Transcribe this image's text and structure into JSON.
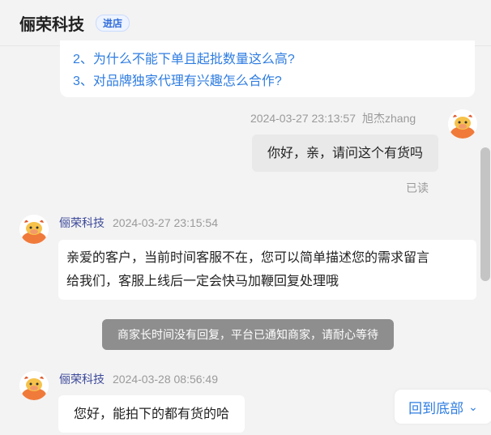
{
  "header": {
    "shop_name": "俪荣科技",
    "badge": "进店"
  },
  "faq": {
    "items": [
      "2、为什么不能下单且起批数量这么高?",
      "3、对品牌独家代理有兴趣怎么合作?"
    ]
  },
  "messages": [
    {
      "sender": "旭杰zhang",
      "time": "2024-03-27 23:13:57",
      "text": "你好，亲，请问这个有货吗",
      "status": "已读"
    },
    {
      "sender": "俪荣科技",
      "time": "2024-03-27 23:15:54",
      "lines": [
        "亲爱的客户，当前时间客服不在，您可以简单描述您的需求留言",
        "给我们，客服上线后一定会快马加鞭回复处理哦"
      ]
    },
    {
      "sender": "俪荣科技",
      "time": "2024-03-28 08:56:49",
      "text": "您好，能拍下的都有货的哈"
    }
  ],
  "system_notice": "商家长时间没有回复，平台已通知商家，请耐心等待",
  "scroll_to_bottom": {
    "label": "回到底部"
  },
  "colors": {
    "link": "#2f7de1",
    "avatar_orange": "#f07a3a",
    "notice_bg": "#8e8e8e"
  },
  "icons": {
    "avatar": "cow-avatar-icon",
    "chevron": "chevron-down-icon"
  }
}
